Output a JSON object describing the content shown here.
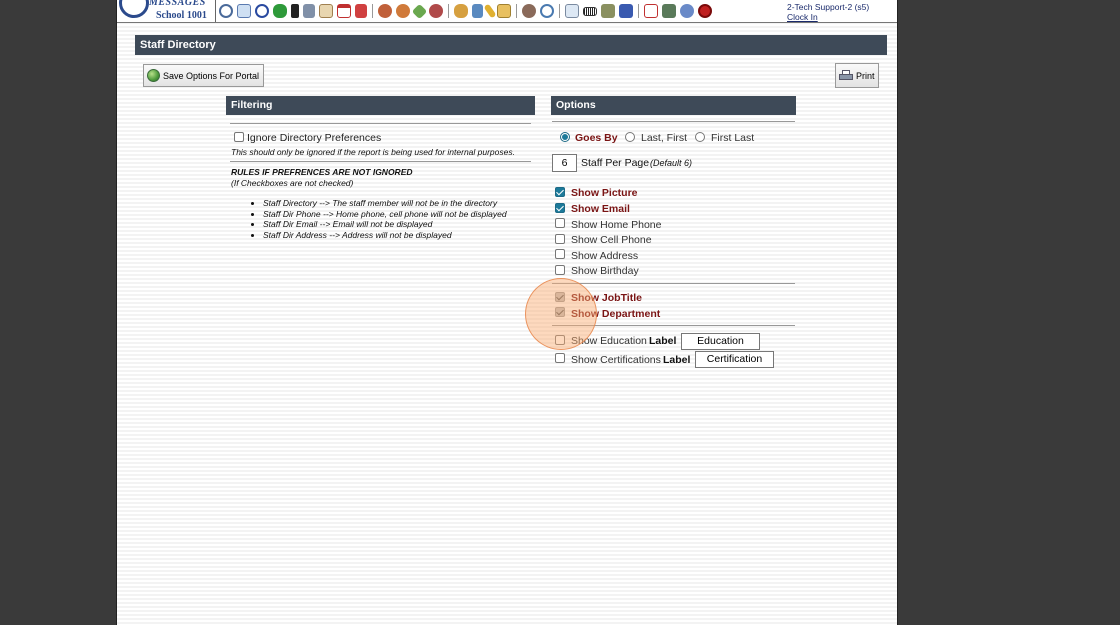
{
  "header": {
    "logo_word": "MESSAGES",
    "school": "School 1001",
    "user": "2-Tech Support-2 (s5)",
    "clock_in": "Clock In",
    "toolbar_icons": [
      "search-icon",
      "grid-icon",
      "at-icon",
      "chat-icon",
      "phone-icon",
      "speaker-icon",
      "newsletter-icon",
      "calendar-icon",
      "megaphone-icon",
      "users-icon",
      "user-icon",
      "tag-icon",
      "people-icon",
      "burger-icon",
      "book-icon",
      "pencil-icon",
      "mail-icon",
      "staff-icon",
      "clock-icon",
      "table-icon",
      "barcode-icon",
      "printer-icon",
      "ap-icon",
      "pdf-icon",
      "cash-icon",
      "help-icon",
      "power-icon"
    ]
  },
  "page": {
    "title": "Staff Directory",
    "save_button": "Save Options For Portal",
    "print_button": "Print"
  },
  "filtering": {
    "heading": "Filtering",
    "ignore_label": "Ignore Directory Preferences",
    "ignore_checked": false,
    "ignore_note": "This should only be ignored if the report is being used for internal purposes.",
    "rules_heading": "RULES IF PREFRENCES ARE NOT IGNORED",
    "rules_sub": "(If Checkboxes are not checked)",
    "rules": [
      "Staff Directory --> The staff member will not be in the directory",
      "Staff Dir Phone --> Home phone, cell phone will not be displayed",
      "Staff Dir Email --> Email will not be displayed",
      "Staff Dir Address --> Address will not be displayed"
    ]
  },
  "options": {
    "heading": "Options",
    "name_format": {
      "selected": "Goes By",
      "choices": [
        "Goes By",
        "Last, First",
        "First Last"
      ]
    },
    "per_page_value": "6",
    "per_page_label": "Staff Per Page",
    "per_page_default": "(Default 6)",
    "show_items": [
      {
        "label": "Show Picture",
        "checked": true
      },
      {
        "label": "Show Email",
        "checked": true
      },
      {
        "label": "Show Home Phone",
        "checked": false
      },
      {
        "label": "Show Cell Phone",
        "checked": false
      },
      {
        "label": "Show Address",
        "checked": false
      },
      {
        "label": "Show Birthday",
        "checked": false
      }
    ],
    "fixed_items": [
      {
        "label": "Show JobTitle",
        "checked": true
      },
      {
        "label": "Show Department",
        "checked": true
      }
    ],
    "label_items": [
      {
        "label": "Show Education",
        "checked": false,
        "label_word": "Label",
        "value": "Education"
      },
      {
        "label": "Show Certifications",
        "checked": false,
        "label_word": "Label",
        "value": "Certification"
      }
    ]
  },
  "colors": {
    "header_bar": "#3e4a58",
    "checked_label": "#7a1414",
    "accent": "#1c7a9a",
    "click_marker": "#f4a46a"
  }
}
